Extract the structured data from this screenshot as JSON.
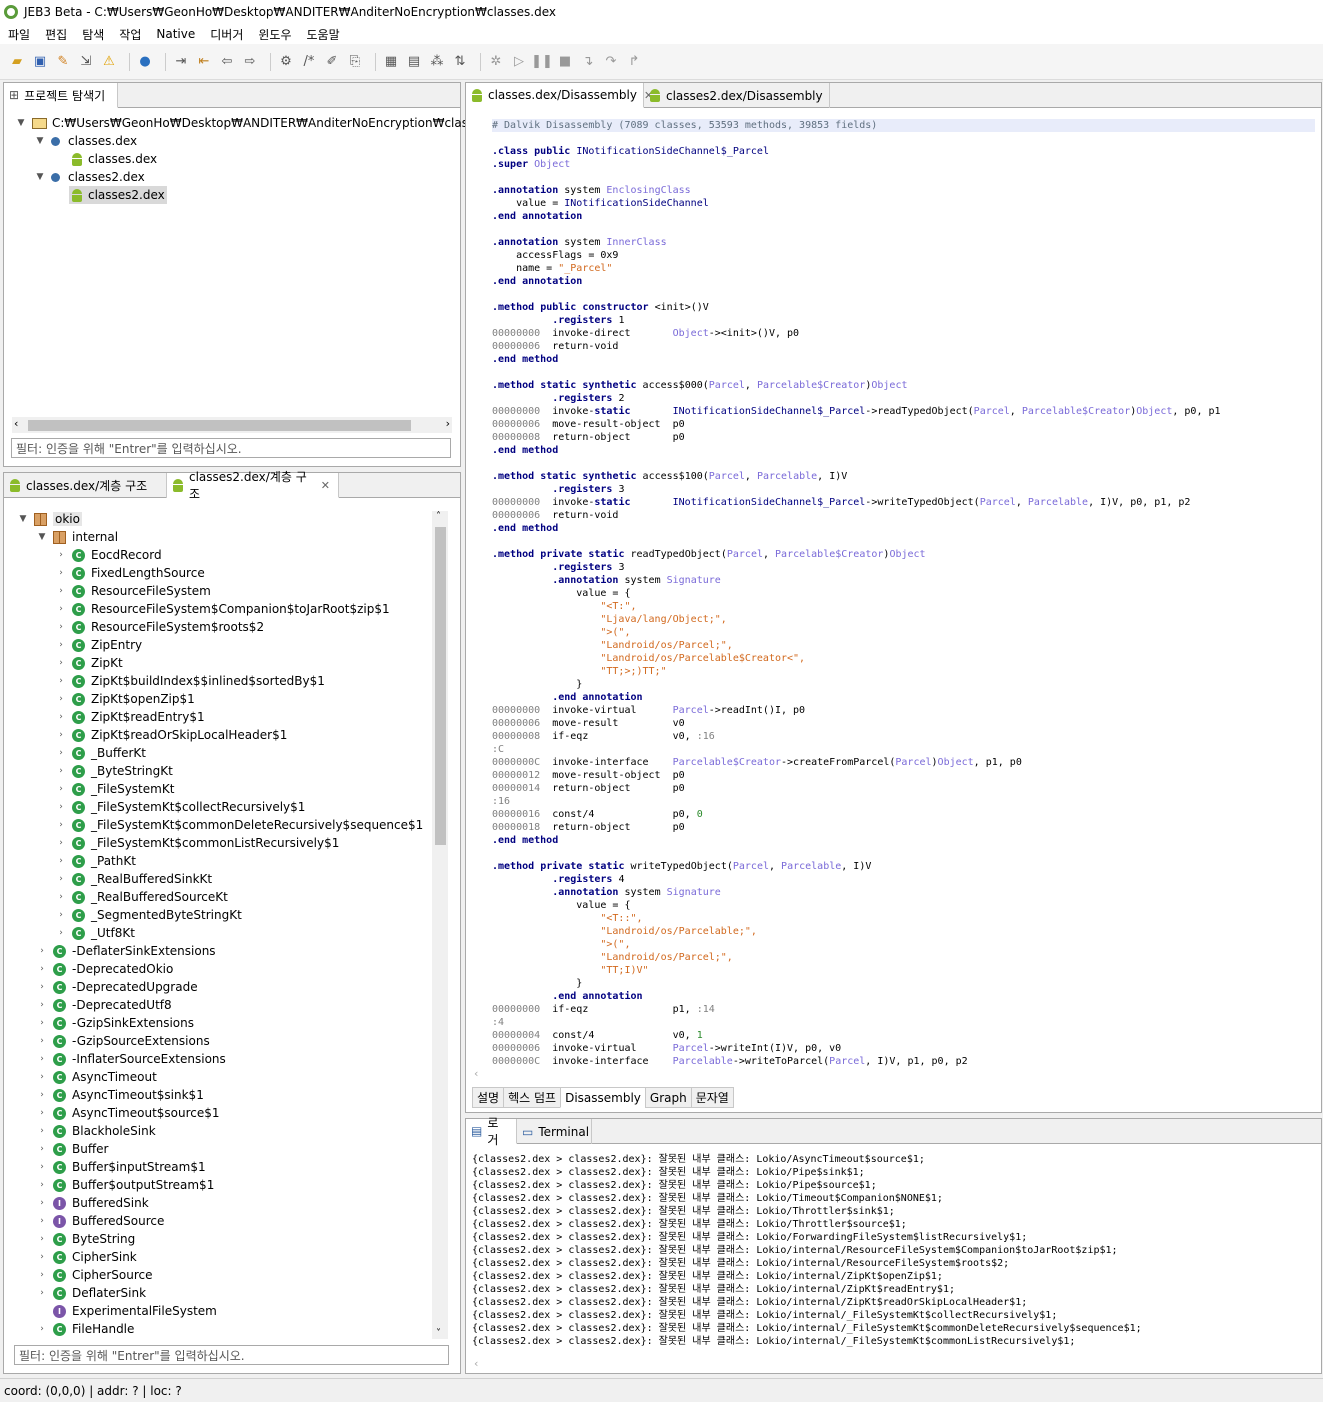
{
  "window": {
    "title": "JEB3 Beta - C:₩Users₩GeonHo₩Desktop₩ANDITER₩AnditerNoEncryption₩classes.dex"
  },
  "menu": [
    "파일",
    "편집",
    "탐색",
    "작업",
    "Native",
    "디버거",
    "윈도우",
    "도움말"
  ],
  "toolbar_icons": [
    "open-icon",
    "save-icon",
    "wrench-icon",
    "export-icon",
    "warning-icon",
    "globe-icon",
    "jump-in-icon",
    "jump-out-icon",
    "back-icon",
    "forward-icon",
    "refactor-icon",
    "comment-icon",
    "pen-icon",
    "import-icon",
    "table-icon",
    "tree-icon",
    "graph-icon",
    "sort-icon",
    "debug-icon",
    "run-icon",
    "pause-icon",
    "stop-icon",
    "step-into-icon",
    "step-over-icon",
    "step-out-icon"
  ],
  "project_explorer": {
    "tab": "프로젝트 탐색기",
    "root": "C:₩Users₩GeonHo₩Desktop₩ANDITER₩AnditerNoEncryption₩classes.dex",
    "items": [
      {
        "label": "classes.dex",
        "child": "classes.dex"
      },
      {
        "label": "classes2.dex",
        "child": "classes2.dex"
      }
    ],
    "filter_placeholder": "필터: 인증을 위해 \"Entrer\"를 입력하십시오."
  },
  "hierarchy": {
    "tabs": [
      "classes.dex/계층 구조",
      "classes2.dex/계층 구조"
    ],
    "package": "okio",
    "subpackage": "internal",
    "internal_classes": [
      "EocdRecord",
      "FixedLengthSource",
      "ResourceFileSystem",
      "ResourceFileSystem$Companion$toJarRoot$zip$1",
      "ResourceFileSystem$roots$2",
      "ZipEntry",
      "ZipKt",
      "ZipKt$buildIndex$$inlined$sortedBy$1",
      "ZipKt$openZip$1",
      "ZipKt$readEntry$1",
      "ZipKt$readOrSkipLocalHeader$1",
      "_BufferKt",
      "_ByteStringKt",
      "_FileSystemKt",
      "_FileSystemKt$collectRecursively$1",
      "_FileSystemKt$commonDeleteRecursively$sequence$1",
      "_FileSystemKt$commonListRecursively$1",
      "_PathKt",
      "_RealBufferedSinkKt",
      "_RealBufferedSourceKt",
      "_SegmentedByteStringKt",
      "_Utf8Kt"
    ],
    "okio_classes": [
      {
        "name": "-DeflaterSinkExtensions",
        "kind": "class"
      },
      {
        "name": "-DeprecatedOkio",
        "kind": "class"
      },
      {
        "name": "-DeprecatedUpgrade",
        "kind": "class"
      },
      {
        "name": "-DeprecatedUtf8",
        "kind": "class"
      },
      {
        "name": "-GzipSinkExtensions",
        "kind": "class"
      },
      {
        "name": "-GzipSourceExtensions",
        "kind": "class"
      },
      {
        "name": "-InflaterSourceExtensions",
        "kind": "class"
      },
      {
        "name": "AsyncTimeout",
        "kind": "class"
      },
      {
        "name": "AsyncTimeout$sink$1",
        "kind": "class"
      },
      {
        "name": "AsyncTimeout$source$1",
        "kind": "class"
      },
      {
        "name": "BlackholeSink",
        "kind": "class"
      },
      {
        "name": "Buffer",
        "kind": "class"
      },
      {
        "name": "Buffer$inputStream$1",
        "kind": "class"
      },
      {
        "name": "Buffer$outputStream$1",
        "kind": "class"
      },
      {
        "name": "BufferedSink",
        "kind": "interface"
      },
      {
        "name": "BufferedSource",
        "kind": "interface"
      },
      {
        "name": "ByteString",
        "kind": "class"
      },
      {
        "name": "CipherSink",
        "kind": "class"
      },
      {
        "name": "CipherSource",
        "kind": "class"
      },
      {
        "name": "DeflaterSink",
        "kind": "class"
      },
      {
        "name": "ExperimentalFileSystem",
        "kind": "interface"
      },
      {
        "name": "FileHandle",
        "kind": "class"
      }
    ],
    "filter_placeholder": "필터: 인증을 위해 \"Entrer\"를 입력하십시오."
  },
  "editor": {
    "tabs": [
      "classes.dex/Disassembly",
      "classes2.dex/Disassembly"
    ],
    "bottom_tabs": [
      "설명",
      "헥스 덤프",
      "Disassembly",
      "Graph",
      "문자열"
    ],
    "lines": [
      "# Dalvik Disassembly (7089 classes, 53593 methods, 39853 fields)",
      "",
      ".class public INotificationSideChannel$_Parcel",
      ".super Object",
      "",
      ".annotation system EnclosingClass",
      "    value = INotificationSideChannel",
      ".end annotation",
      "",
      ".annotation system InnerClass",
      "    accessFlags = 0x9",
      "    name = \"_Parcel\"",
      ".end annotation",
      "",
      ".method public constructor <init>()V",
      "          .registers 1",
      "00000000  invoke-direct       Object-><init>()V, p0",
      "00000006  return-void",
      ".end method",
      "",
      ".method static synthetic access$000(Parcel, Parcelable$Creator)Object",
      "          .registers 2",
      "00000000  invoke-static       INotificationSideChannel$_Parcel->readTypedObject(Parcel, Parcelable$Creator)Object, p0, p1",
      "00000006  move-result-object  p0",
      "00000008  return-object       p0",
      ".end method",
      "",
      ".method static synthetic access$100(Parcel, Parcelable, I)V",
      "          .registers 3",
      "00000000  invoke-static       INotificationSideChannel$_Parcel->writeTypedObject(Parcel, Parcelable, I)V, p0, p1, p2",
      "00000006  return-void",
      ".end method",
      "",
      ".method private static readTypedObject(Parcel, Parcelable$Creator)Object",
      "          .registers 3",
      "          .annotation system Signature",
      "              value = {",
      "                  \"<T:\",",
      "                  \"Ljava/lang/Object;\",",
      "                  \">(\",",
      "                  \"Landroid/os/Parcel;\",",
      "                  \"Landroid/os/Parcelable$Creator<\",",
      "                  \"TT;>;)TT;\"",
      "              }",
      "          .end annotation",
      "00000000  invoke-virtual      Parcel->readInt()I, p0",
      "00000006  move-result         v0",
      "00000008  if-eqz              v0, :16",
      ":C",
      "0000000C  invoke-interface    Parcelable$Creator->createFromParcel(Parcel)Object, p1, p0",
      "00000012  move-result-object  p0",
      "00000014  return-object       p0",
      ":16",
      "00000016  const/4             p0, 0",
      "00000018  return-object       p0",
      ".end method",
      "",
      ".method private static writeTypedObject(Parcel, Parcelable, I)V",
      "          .registers 4",
      "          .annotation system Signature",
      "              value = {",
      "                  \"<T::\",",
      "                  \"Landroid/os/Parcelable;\",",
      "                  \">(\",",
      "                  \"Landroid/os/Parcel;\",",
      "                  \"TT;I)V\"",
      "              }",
      "          .end annotation",
      "00000000  if-eqz              p1, :14",
      ":4",
      "00000004  const/4             v0, 1",
      "00000006  invoke-virtual      Parcel->writeInt(I)V, p0, v0",
      "0000000C  invoke-interface    Parcelable->writeToParcel(Parcel, I)V, p1, p0, p2"
    ]
  },
  "console": {
    "tabs": [
      "로거",
      "Terminal"
    ],
    "lines": [
      "{classes2.dex > classes2.dex}: 잘못된 내부 클래스: Lokio/AsyncTimeout$source$1;",
      "{classes2.dex > classes2.dex}: 잘못된 내부 클래스: Lokio/Pipe$sink$1;",
      "{classes2.dex > classes2.dex}: 잘못된 내부 클래스: Lokio/Pipe$source$1;",
      "{classes2.dex > classes2.dex}: 잘못된 내부 클래스: Lokio/Timeout$Companion$NONE$1;",
      "{classes2.dex > classes2.dex}: 잘못된 내부 클래스: Lokio/Throttler$sink$1;",
      "{classes2.dex > classes2.dex}: 잘못된 내부 클래스: Lokio/Throttler$source$1;",
      "{classes2.dex > classes2.dex}: 잘못된 내부 클래스: Lokio/ForwardingFileSystem$listRecursively$1;",
      "{classes2.dex > classes2.dex}: 잘못된 내부 클래스: Lokio/internal/ResourceFileSystem$Companion$toJarRoot$zip$1;",
      "{classes2.dex > classes2.dex}: 잘못된 내부 클래스: Lokio/internal/ResourceFileSystem$roots$2;",
      "{classes2.dex > classes2.dex}: 잘못된 내부 클래스: Lokio/internal/ZipKt$openZip$1;",
      "{classes2.dex > classes2.dex}: 잘못된 내부 클래스: Lokio/internal/ZipKt$readEntry$1;",
      "{classes2.dex > classes2.dex}: 잘못된 내부 클래스: Lokio/internal/ZipKt$readOrSkipLocalHeader$1;",
      "{classes2.dex > classes2.dex}: 잘못된 내부 클래스: Lokio/internal/_FileSystemKt$collectRecursively$1;",
      "{classes2.dex > classes2.dex}: 잘못된 내부 클래스: Lokio/internal/_FileSystemKt$commonDeleteRecursively$sequence$1;",
      "{classes2.dex > classes2.dex}: 잘못된 내부 클래스: Lokio/internal/_FileSystemKt$commonListRecursively$1;"
    ]
  },
  "status": "coord: (0,0,0) | addr: ? | loc: ?"
}
